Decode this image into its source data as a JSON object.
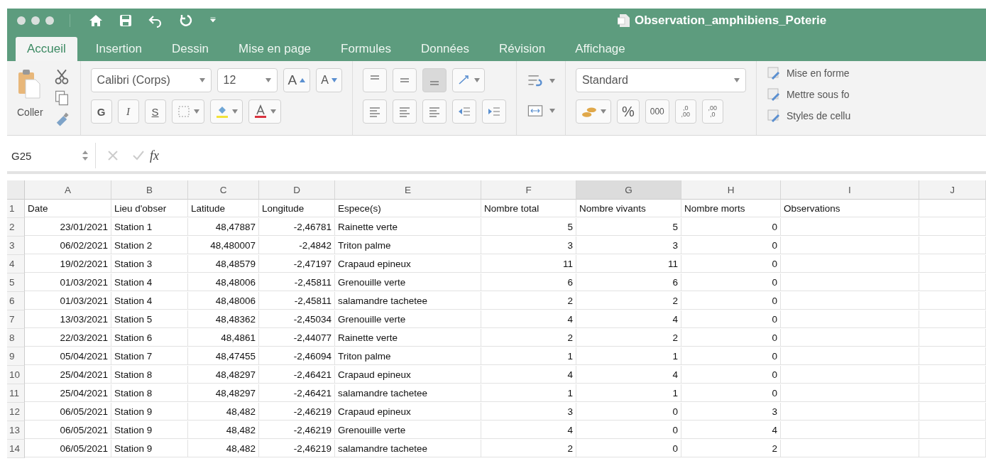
{
  "window": {
    "title": "Observation_amphibiens_Poterie"
  },
  "tabs": [
    {
      "label": "Accueil",
      "selected": true
    },
    {
      "label": "Insertion",
      "selected": false
    },
    {
      "label": "Dessin",
      "selected": false
    },
    {
      "label": "Mise en page",
      "selected": false
    },
    {
      "label": "Formules",
      "selected": false
    },
    {
      "label": "Données",
      "selected": false
    },
    {
      "label": "Révision",
      "selected": false
    },
    {
      "label": "Affichage",
      "selected": false
    }
  ],
  "ribbon": {
    "paste_label": "Coller",
    "font_name": "Calibri (Corps)",
    "font_size": "12",
    "grow_font": "A",
    "shrink_font": "A",
    "format_buttons": [
      "G",
      "I",
      "S"
    ],
    "vertical_align": [
      {
        "kind": "top",
        "selected": false
      },
      {
        "kind": "middle",
        "selected": false
      },
      {
        "kind": "bottom",
        "selected": true
      }
    ],
    "number_format": "Standard",
    "percent": "%",
    "thousands": "000",
    "decimals_more": {
      "top": ",0",
      "bottom": ",00"
    },
    "decimals_less": {
      "top": ",00",
      "bottom": ",0"
    },
    "styles": [
      "Mise en forme",
      "Mettre sous fo",
      "Styles de cellu"
    ]
  },
  "formula_bar": {
    "cell_ref": "G25",
    "fx": "fx"
  },
  "sheet": {
    "columns": [
      {
        "label": "A",
        "kind": "number",
        "selected": false
      },
      {
        "label": "B",
        "kind": "text",
        "selected": false
      },
      {
        "label": "C",
        "kind": "number",
        "selected": false
      },
      {
        "label": "D",
        "kind": "number",
        "selected": false
      },
      {
        "label": "E",
        "kind": "text",
        "selected": false
      },
      {
        "label": "F",
        "kind": "number",
        "selected": false
      },
      {
        "label": "G",
        "kind": "number",
        "selected": true
      },
      {
        "label": "H",
        "kind": "number",
        "selected": false
      },
      {
        "label": "I",
        "kind": "text",
        "selected": false
      },
      {
        "label": "J",
        "kind": "text",
        "selected": false
      }
    ],
    "rows": [
      {
        "number": "1",
        "kind": "header",
        "cells": [
          "Date",
          "Lieu d'obser",
          "Latitude",
          "Longitude",
          "Espece(s)",
          "Nombre total",
          "Nombre vivants",
          "Nombre morts",
          "Observations"
        ]
      },
      {
        "number": "2",
        "kind": "data",
        "cells": [
          "23/01/2021",
          "Station 1",
          "48,47887",
          "-2,46781",
          "Rainette verte",
          "5",
          "5",
          "0"
        ]
      },
      {
        "number": "3",
        "kind": "data",
        "cells": [
          "06/02/2021",
          "Station 2",
          "48,480007",
          "-2,4842",
          "Triton palme",
          "3",
          "3",
          "0"
        ]
      },
      {
        "number": "4",
        "kind": "data",
        "cells": [
          "19/02/2021",
          "Station 3",
          "48,48579",
          "-2,47197",
          "Crapaud epineux",
          "11",
          "11",
          "0"
        ]
      },
      {
        "number": "5",
        "kind": "data",
        "cells": [
          "01/03/2021",
          "Station 4",
          "48,48006",
          "-2,45811",
          "Grenouille verte",
          "6",
          "6",
          "0"
        ]
      },
      {
        "number": "6",
        "kind": "data",
        "cells": [
          "01/03/2021",
          "Station 4",
          "48,48006",
          "-2,45811",
          "salamandre tachetee",
          "2",
          "2",
          "0"
        ]
      },
      {
        "number": "7",
        "kind": "data",
        "cells": [
          "13/03/2021",
          "Station 5",
          "48,48362",
          "-2,45034",
          "Grenouille verte",
          "4",
          "4",
          "0"
        ]
      },
      {
        "number": "8",
        "kind": "data",
        "cells": [
          "22/03/2021",
          "Station 6",
          "48,4861",
          "-2,44077",
          "Rainette verte",
          "2",
          "2",
          "0"
        ]
      },
      {
        "number": "9",
        "kind": "data",
        "cells": [
          "05/04/2021",
          "Station 7",
          "48,47455",
          "-2,46094",
          "Triton palme",
          "1",
          "1",
          "0"
        ]
      },
      {
        "number": "10",
        "kind": "data",
        "cells": [
          "25/04/2021",
          "Station 8",
          "48,48297",
          "-2,46421",
          "Crapaud epineux",
          "4",
          "4",
          "0"
        ]
      },
      {
        "number": "11",
        "kind": "data",
        "cells": [
          "25/04/2021",
          "Station 8",
          "48,48297",
          "-2,46421",
          "salamandre tachetee",
          "1",
          "1",
          "0"
        ]
      },
      {
        "number": "12",
        "kind": "data",
        "cells": [
          "06/05/2021",
          "Station 9",
          "48,482",
          "-2,46219",
          "Crapaud epineux",
          "3",
          "0",
          "3"
        ]
      },
      {
        "number": "13",
        "kind": "data",
        "cells": [
          "06/05/2021",
          "Station 9",
          "48,482",
          "-2,46219",
          "Grenouille verte",
          "4",
          "0",
          "4"
        ]
      },
      {
        "number": "14",
        "kind": "data",
        "cells": [
          "06/05/2021",
          "Station 9",
          "48,482",
          "-2,46219",
          "salamandre tachetee",
          "2",
          "0",
          "2"
        ]
      }
    ]
  }
}
